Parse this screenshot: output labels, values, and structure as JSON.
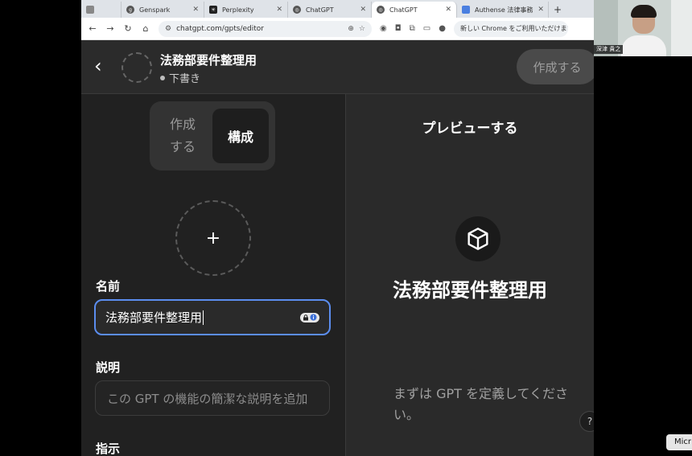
{
  "browser": {
    "tabs": [
      {
        "label": "",
        "icon": "window-icon"
      },
      {
        "label": "Genspark",
        "icon": "genspark-icon"
      },
      {
        "label": "Perplexity",
        "icon": "perplexity-icon"
      },
      {
        "label": "ChatGPT",
        "icon": "chatgpt-icon"
      },
      {
        "label": "ChatGPT",
        "icon": "chatgpt-icon",
        "active": true
      },
      {
        "label": "Authense 法律事務",
        "icon": "document-icon"
      }
    ],
    "new_tab_label": "+",
    "url": "chatgpt.com/gpts/editor",
    "chrome_notice": "新しい Chrome をご利用いただけます"
  },
  "header": {
    "gpt_title": "法務部要件整理用",
    "status": "下書き",
    "create_button": "作成する"
  },
  "left": {
    "segment_create": "作成\nする",
    "segment_configure": "構成",
    "add_image": "+",
    "name_label": "名前",
    "name_value": "法務部要件整理用",
    "description_label": "説明",
    "description_placeholder": "この GPT の機能の簡潔な説明を追加",
    "instructions_label": "指示"
  },
  "preview": {
    "title": "プレビューする",
    "gpt_name": "法務部要件整理用",
    "hint": "まずは GPT を定義してください。",
    "help": "?"
  },
  "meeting": {
    "participant_name": "深津 貴之",
    "mic_button": "Micr"
  },
  "colors": {
    "accent_focus": "#5b8def",
    "app_bg": "#212121",
    "preview_bg": "#2a2a2a"
  }
}
